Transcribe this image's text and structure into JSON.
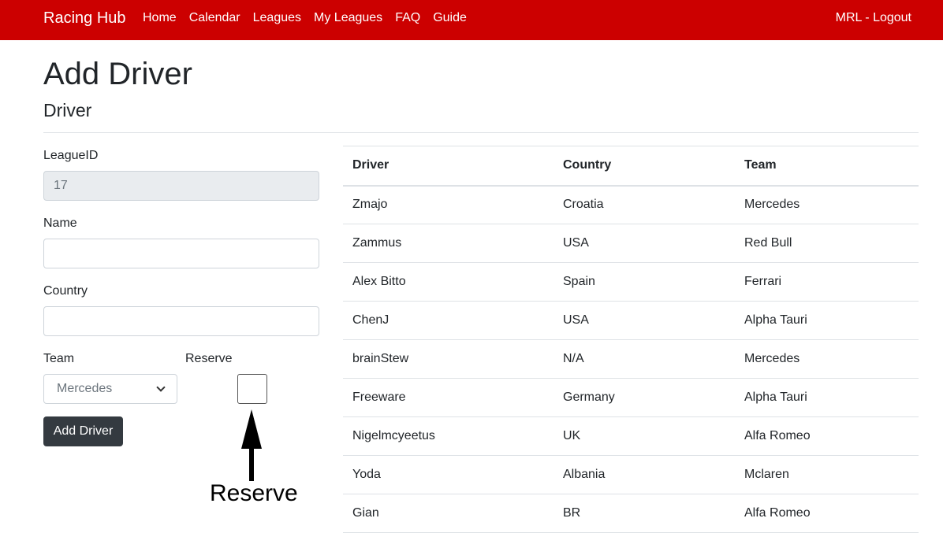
{
  "nav": {
    "brand": "Racing Hub",
    "links": [
      "Home",
      "Calendar",
      "Leagues",
      "My Leagues",
      "FAQ",
      "Guide"
    ],
    "account": "MRL - Logout"
  },
  "page": {
    "title": "Add Driver",
    "section": "Driver"
  },
  "form": {
    "league_label": "LeagueID",
    "league_value": "17",
    "name_label": "Name",
    "name_value": "",
    "country_label": "Country",
    "country_value": "",
    "team_label": "Team",
    "team_selected": "Mercedes",
    "reserve_label": "Reserve",
    "submit_label": "Add Driver"
  },
  "annotation": {
    "text": "Reserve"
  },
  "table": {
    "headers": [
      "Driver",
      "Country",
      "Team"
    ],
    "rows": [
      [
        "Zmajo",
        "Croatia",
        "Mercedes"
      ],
      [
        "Zammus",
        "USA",
        "Red Bull"
      ],
      [
        "Alex Bitto",
        "Spain",
        "Ferrari"
      ],
      [
        "ChenJ",
        "USA",
        "Alpha Tauri"
      ],
      [
        "brainStew",
        "N/A",
        "Mercedes"
      ],
      [
        "Freeware",
        "Germany",
        "Alpha Tauri"
      ],
      [
        "Nigelmcyeetus",
        "UK",
        "Alfa Romeo"
      ],
      [
        "Yoda",
        "Albania",
        "Mclaren"
      ],
      [
        "Gian",
        "BR",
        "Alfa Romeo"
      ]
    ]
  }
}
